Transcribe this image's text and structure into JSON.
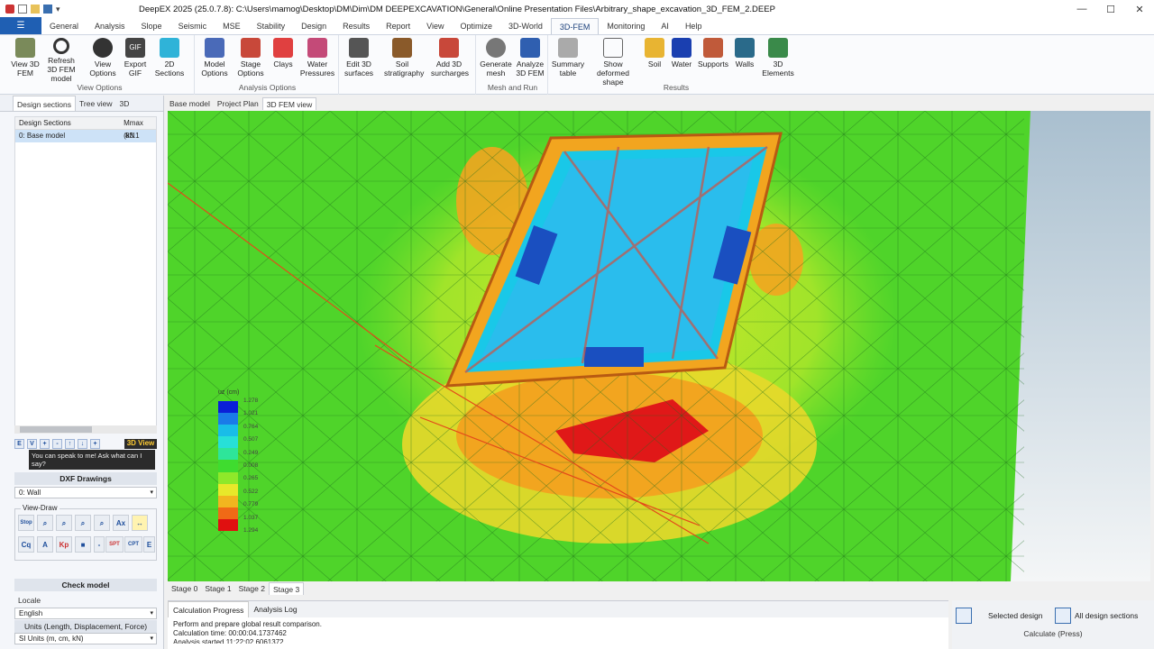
{
  "window": {
    "title": "DeepEX 2025  (25.0.7.8): C:\\Users\\mamog\\Desktop\\DM\\Dim\\DM DEEPEXCAVATION\\General\\Online Presentation Files\\Arbitrary_shape_excavation_3D_FEM_2.DEEP",
    "minimize": "—",
    "maximize": "☐",
    "close": "✕"
  },
  "menu_tabs": [
    "General",
    "Analysis",
    "Slope",
    "Seismic",
    "MSE",
    "Stability",
    "Design",
    "Results",
    "Report",
    "View",
    "Optimize",
    "3D-World",
    "3D-FEM",
    "Monitoring",
    "AI",
    "Help"
  ],
  "active_tab": "3D-FEM",
  "ribbon": {
    "groups": [
      {
        "label": "View Options",
        "buttons": [
          "View 3D FEM",
          "Refresh 3D FEM model",
          "View Options",
          "Export GIF",
          "2D Sections"
        ]
      },
      {
        "label": "Analysis Options",
        "buttons": [
          "Model Options",
          "Stage Options",
          "Clays",
          "Water Pressures"
        ]
      },
      {
        "label": "",
        "buttons": [
          "Edit 3D surfaces",
          "Soil stratigraphy",
          "Add 3D surcharges"
        ]
      },
      {
        "label": "Mesh and Run",
        "buttons": [
          "Generate mesh",
          "Analyze 3D FEM"
        ]
      },
      {
        "label": "Results",
        "buttons": [
          "Summary table",
          "Show deformed shape",
          "Soil",
          "Water",
          "Supports",
          "Walls",
          "3D Elements"
        ]
      }
    ]
  },
  "left_panel": {
    "tabs": [
      "Design sections",
      "Tree view",
      "3D"
    ],
    "table_headers": [
      "Design Sections",
      "Mmax (kN"
    ],
    "rows": [
      {
        "name": "0: Base model",
        "value": "83.1"
      }
    ],
    "toolbar": [
      "E",
      "V",
      "+",
      "-",
      "↑",
      "↓",
      "+"
    ],
    "view_label": "3D View",
    "assistant_text": "You can speak to me! Ask what can I say?",
    "dxf_title": "DXF Drawings",
    "dxf_item": "0: Wall",
    "view_draw_label": "View-Draw",
    "view_draw_buttons": [
      "Stop",
      "⌕",
      "⌕",
      "⌕",
      "⌕",
      "Ax",
      "↔",
      "Cq",
      "A",
      "Kp",
      "■",
      "-",
      "SPT",
      "CPT",
      "E"
    ],
    "check_model": "Check model",
    "locale_title": "Locale",
    "language": "English",
    "units_title": "Units (Length, Displacement, Force)",
    "units": "SI Units (m, cm, kN)"
  },
  "view_tabs": [
    "Base model",
    "Project Plan",
    "3D FEM view"
  ],
  "active_view_tab": "3D FEM view",
  "legend": {
    "title": "uz (cm)",
    "labels": [
      "1.278",
      "1.021",
      "0.764",
      "0.507",
      "0.249",
      "0.008",
      "0.265",
      "0.522",
      "0.779",
      "1.037",
      "1.294"
    ],
    "colors": [
      "#0a1fd8",
      "#1a7be8",
      "#19bde8",
      "#27e0d8",
      "#2ee59a",
      "#3fdc2f",
      "#8fe82a",
      "#e8e82a",
      "#f2b51f",
      "#f06a16",
      "#e01010"
    ]
  },
  "stage_tabs": [
    "Stage 0",
    "Stage 1",
    "Stage 2",
    "Stage 3"
  ],
  "active_stage": "Stage 3",
  "output": {
    "tabs": [
      "Calculation Progress",
      "Analysis Log"
    ],
    "lines": [
      "Perform and prepare global result comparison.",
      "Calculation time: 00:00:04.1737462",
      "Analysis started 11:22:02.6061372"
    ]
  },
  "calc": {
    "selected": "Selected design",
    "all": "All design sections",
    "label": "Calculate (Press)"
  }
}
